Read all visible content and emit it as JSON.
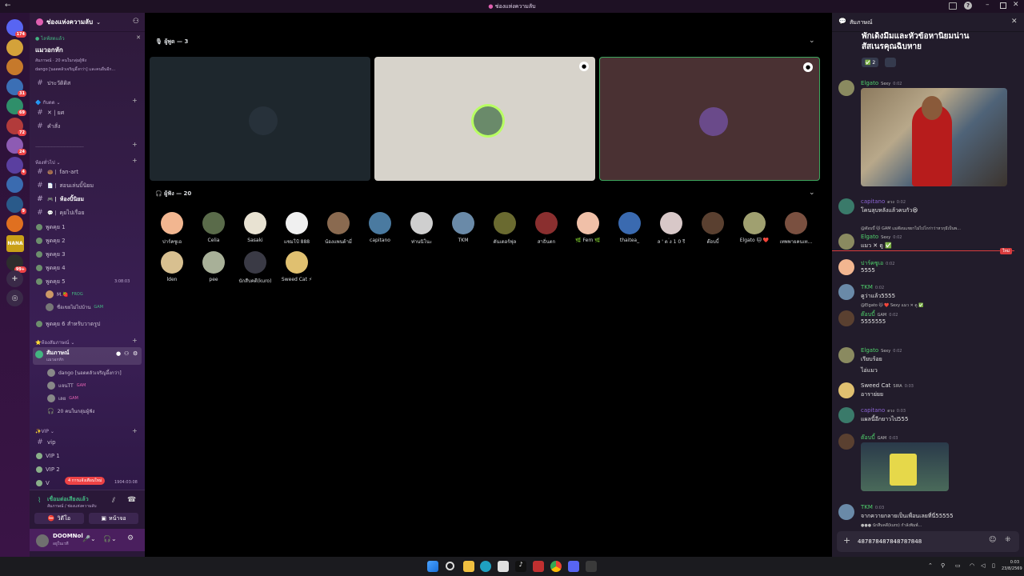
{
  "titlebar": {
    "title": "ช่องแห่งความลับ"
  },
  "rail": {
    "servers": [
      {
        "badge": "174",
        "color": "#5865f2"
      },
      {
        "badge": "",
        "color": "#d4a23a"
      },
      {
        "badge": "",
        "color": "#c6792b"
      },
      {
        "badge": "31",
        "color": "#3b6fb5"
      },
      {
        "badge": "69",
        "color": "#2f8f6a"
      },
      {
        "badge": "72",
        "color": "#b23b3b"
      },
      {
        "badge": "24",
        "color": "#8d5bb3"
      },
      {
        "badge": "4",
        "color": "#5a3fa0"
      },
      {
        "badge": "",
        "color": "#3a6bb0"
      },
      {
        "badge": "9",
        "color": "#2a5a8a"
      },
      {
        "badge": "",
        "color": "#e07020"
      },
      {
        "badge": "",
        "color": "#c9a018",
        "text": "NANA"
      },
      {
        "badge": "99+",
        "color": "#2d2d2d"
      }
    ]
  },
  "sidebar": {
    "server_name": "ช่องแห่งความลับ",
    "event": {
      "tag": "ไลฟ์สดแล้ว",
      "title": "แมวอกหัก",
      "sub": "สัมภาษณ์ · 20 คนในกลุ่มผู้ฟัง",
      "sub2": "dango [นอดตลัวเจริญอึ้งกว่า] และคนอื่นอีก..."
    },
    "ch_main": "ประวัติดิส",
    "cat_rules": "กับดด",
    "ch_rules": [
      {
        "label": "✕ | ยศ"
      },
      {
        "label": "คำสั่ง"
      }
    ],
    "divider": "———————————————",
    "cat_general": "ห้องทั่วไป",
    "ch_general": [
      {
        "label": "fan-art",
        "icon": "🍩 |"
      },
      {
        "label": "สอนเล่นบิ้นิยม",
        "icon": "📄 |"
      },
      {
        "label": "ห้องบิ้นิยม",
        "icon": "🎮 |"
      },
      {
        "label": "คุยไปเรื่อย",
        "icon": "💬 |"
      }
    ],
    "voice_general": [
      "พูดคุย 1",
      "พูดคุย 2",
      "พูดคุย 3",
      "พูดคุย 4",
      "พูดคุย 5"
    ],
    "voice5_time": "3:08:03",
    "voice5_users": [
      {
        "name": "M.🍓",
        "tag": "FROG"
      },
      {
        "name": "ชื่อเขยไม่ไปบ้าน",
        "tag": "GAM"
      }
    ],
    "voice6": "พูดคุย 6 สำหรับวาดรูป",
    "cat_stage": "ห้องสัมภาษณ์",
    "stage": {
      "name": "สัมภาษณ์",
      "sub": "แมวอกหัก"
    },
    "stage_users": [
      {
        "name": "dango [นอดตลัวเจริญอึ้งกว่า]",
        "tag": ""
      },
      {
        "name": "แจนTT",
        "tag": "GAM"
      },
      {
        "name": "เลย",
        "tag": "GAM"
      }
    ],
    "stage_audience": "20 คนในกลุ่มผู้ฟัง",
    "cat_vip": "VIP",
    "ch_vip": [
      {
        "label": "vip"
      },
      {
        "label": "VIP 1"
      },
      {
        "label": "VIP 2"
      },
      {
        "label": "V"
      }
    ],
    "vip_time": "1904:03:08",
    "new_badge": "4 การแจ้งเตือนใหม่",
    "voice_status": {
      "title": "เชื่อมต่อเสียงแล้ว",
      "sub": "สัมภาษณ์ / ช่องแห่งความลับ"
    },
    "video_btn": "วิดีโอ",
    "screen_btn": "หน้าจอ",
    "user": {
      "name": "DOOMNol",
      "status": "อยู่ในเวที"
    }
  },
  "main": {
    "speakers_label": "ผู้พูด — 3",
    "audience_label": "ผู้ฟัง — 20",
    "tiles": [
      {
        "bg": "#1e272d",
        "ring": "none"
      },
      {
        "bg": "#d7d3cb",
        "ring": "#b8ff62"
      },
      {
        "bg": "#4a3133",
        "ring": "none"
      }
    ],
    "audience": [
      {
        "name": "ปาร์คซูเอ",
        "color": "#f2b690"
      },
      {
        "name": "Celia",
        "color": "#5a6b4a"
      },
      {
        "name": "Sasaki",
        "color": "#e8e2d2"
      },
      {
        "name": "แชมโป้ 888",
        "color": "#f0f0f0"
      },
      {
        "name": "น้องแพนด้ามี่",
        "color": "#8a6a50"
      },
      {
        "name": "capitano",
        "color": "#4a7aa0"
      },
      {
        "name": "ท่านนิโนะ",
        "color": "#cfcfcf"
      },
      {
        "name": "TKM",
        "color": "#6a8aa8"
      },
      {
        "name": "ดันเดอร์ฟุล",
        "color": "#6a6a30"
      },
      {
        "name": "สาธิ่นตก",
        "color": "#8a2f2f"
      },
      {
        "name": "🌿 Fern 🌿",
        "color": "#f0c0a8"
      },
      {
        "name": "thaitea_",
        "color": "#3a6ab0"
      },
      {
        "name": "ล ' ด ่ง 1 0 รี",
        "color": "#d8c8c8"
      },
      {
        "name": "ต๊อบบี้",
        "color": "#5a4030"
      },
      {
        "name": "Elgato 🐱 ❤️",
        "color": "#a0a070"
      },
      {
        "name": "เทพพายคนเท...",
        "color": "#7a5040"
      },
      {
        "name": "lden",
        "color": "#d8c090"
      },
      {
        "name": "pee",
        "color": "#a8b098"
      },
      {
        "name": "นักสืบคดี(kuro)",
        "color": "#3a3a45"
      },
      {
        "name": "Sweed Cat ⚡",
        "color": "#e0c070"
      }
    ]
  },
  "chat": {
    "header": "สัมภาษณ์",
    "top_text_1": "พักเด็งมีมและหัวข้อหานิยมน่าน",
    "top_text_2": "สัสเนรคุณฉิบหาย",
    "reaction_check": "✅ 2",
    "messages": [
      {
        "name": "Elgato",
        "tag": "Sexy",
        "time": "0:02",
        "text": "",
        "name_color": "#4fd16b",
        "av": "#8a8a60"
      },
      {
        "name": "capitano",
        "tag": "ดวง",
        "time": "0:02",
        "text": "โคนลุบหลังแล้วคบกัว😆",
        "name_color": "#8a63d2",
        "av": "#3a7a6a"
      },
      {
        "name": "Elgato",
        "tag": "Sexy",
        "time": "0:02",
        "text": "แมว ✕ ดู ✅",
        "name_color": "#4fd16b",
        "av": "#8a8a60",
        "reply": "@ต๊อบบี้ 🐱 GAM แม่ต๊อบแชยาไม่ไปโกก่าว่าหวกุมีเป็นพ..."
      },
      {
        "name": "ปาร์คซูเอ",
        "tag": "",
        "time": "0:02",
        "text": "5555",
        "name_color": "#4fd16b",
        "av": "#f2b690"
      },
      {
        "name": "TKM",
        "tag": "",
        "time": "0:02",
        "text": "คูว่าแล้ว5555",
        "name_color": "#4fd16b",
        "av": "#6a8aa8"
      },
      {
        "name": "ต๊อบบี้",
        "tag": "GAM",
        "time": "0:02",
        "text": "5555555",
        "name_color": "#4fd16b",
        "av": "#5a4030",
        "reply": "@Elgato 🐱 ❤️ Sexy แมว ✕ ดู ✅"
      },
      {
        "name": "Elgato",
        "tag": "Sexy",
        "time": "0:02",
        "text": "เรียบร้อย",
        "text2": "ไอ่แมว",
        "name_color": "#4fd16b",
        "av": "#8a8a60"
      },
      {
        "name": "Sweed Cat",
        "tag": "SIRA",
        "time": "0:03",
        "text": "อาราย่ยย",
        "name_color": "#e0e0e0",
        "av": "#e0c070"
      },
      {
        "name": "capitano",
        "tag": "ดวง",
        "time": "0:03",
        "text": "แผลนี้อีกยาวไป555",
        "name_color": "#8a63d2",
        "av": "#3a7a6a"
      },
      {
        "name": "ต๊อบบี้",
        "tag": "GAM",
        "time": "0:03",
        "text": "",
        "name_color": "#4fd16b",
        "av": "#5a4030"
      },
      {
        "name": "TKM",
        "tag": "",
        "time": "0:03",
        "text": "จากควายกลายเป็นเพื่อนเลยที่นี่55555",
        "name_color": "#4fd16b",
        "av": "#6a8aa8"
      }
    ],
    "typing": "นักสืบคดี(kuro) กำลังพิมพ์...",
    "new_label": "ใหม่",
    "input_value": "487878487848787848"
  },
  "taskbar": {
    "time": "0:03",
    "date": "23/8/2569"
  }
}
